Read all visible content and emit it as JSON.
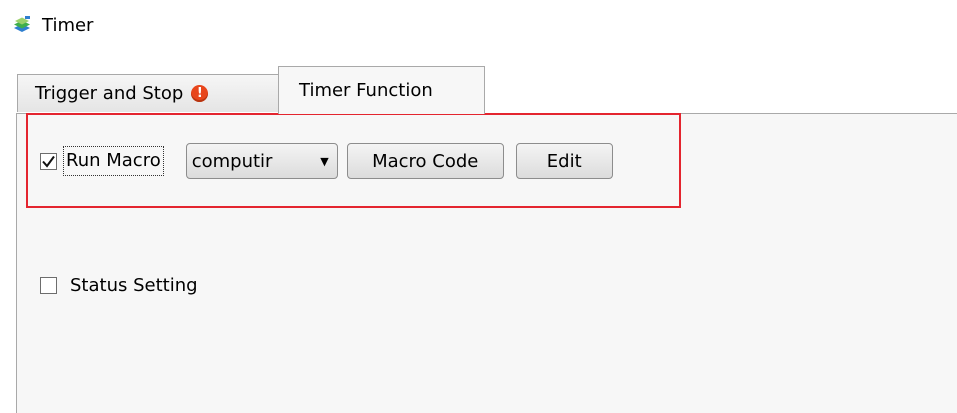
{
  "window": {
    "title": "Timer",
    "icon": "app-stack-icon"
  },
  "tabs": [
    {
      "label": "Trigger and Stop",
      "icon": "warning-icon",
      "warning_glyph": "!"
    },
    {
      "label": "Timer Function",
      "active": true
    }
  ],
  "run_macro": {
    "checked": true,
    "label": "Run Macro",
    "macro_select": {
      "value": "computir",
      "caret": "▼"
    },
    "macro_code_button": "Macro Code",
    "edit_button": "Edit"
  },
  "status_setting": {
    "checked": false,
    "label": "Status Setting"
  },
  "colors": {
    "highlight": "#e4252f",
    "warning": "#e8461c"
  }
}
